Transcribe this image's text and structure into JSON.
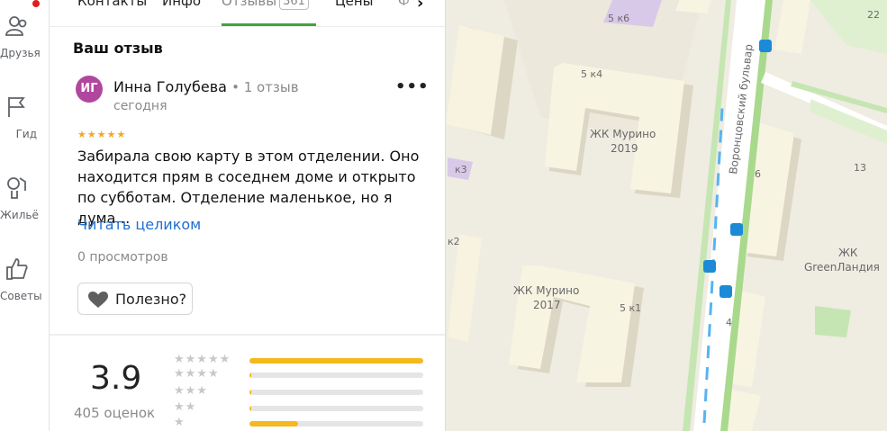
{
  "rail": {
    "items": [
      {
        "label": "Друзья",
        "icon": "friends-icon"
      },
      {
        "label": "Гид",
        "icon": "flag-icon"
      },
      {
        "label": "Жильё",
        "icon": "housing-icon"
      },
      {
        "label": "Советы",
        "icon": "thumbs-up-icon"
      }
    ]
  },
  "tabs": {
    "contacts": "Контакты",
    "info": "Инфо",
    "reviews": "Отзывы",
    "reviews_count": "361",
    "prices": "Цены",
    "next": "Ф"
  },
  "review": {
    "section_title": "Ваш отзыв",
    "avatar_initials": "ИГ",
    "author": "Инна Голубева",
    "meta": "1 отзыв",
    "date": "сегодня",
    "rating_stars": 5,
    "text": "Забирала свою карту в этом отделении. Оно находится прям в соседнем доме и открыто по субботам. Отделение маленькое, но я дума…",
    "read_more": "Читать целиком",
    "views": "0 просмотров",
    "useful": "Полезно?"
  },
  "summary": {
    "rating": "3.9",
    "count": "405 оценок",
    "distribution": [
      {
        "stars": 5,
        "fraction": 1.0
      },
      {
        "stars": 4,
        "fraction": 0.01
      },
      {
        "stars": 3,
        "fraction": 0.01
      },
      {
        "stars": 2,
        "fraction": 0.01
      },
      {
        "stars": 1,
        "fraction": 0.28
      }
    ]
  },
  "map": {
    "labels": [
      {
        "text": "5 к6"
      },
      {
        "text": "5 к4"
      },
      {
        "text": "ЖК Мурино"
      },
      {
        "text": "2019"
      },
      {
        "text": "ЖК Мурино"
      },
      {
        "text": "2017"
      },
      {
        "text": "5 к1"
      },
      {
        "text": "к2"
      },
      {
        "text": "к3"
      },
      {
        "text": "6"
      },
      {
        "text": "13"
      },
      {
        "text": "4"
      },
      {
        "text": "22"
      },
      {
        "text": "ЖК"
      },
      {
        "text": "GreenЛандия"
      },
      {
        "text": "Воронцовский бульвар"
      }
    ]
  },
  "colors": {
    "accent_green": "#3fa537",
    "link_blue": "#1e6fd1",
    "star_gold": "#f5a623",
    "bar_fill": "#f5b81d",
    "avatar": "#b0479e",
    "map_bg": "#f2efe6",
    "building": "#f6f1dd",
    "transit_blue": "#1c8ad6"
  }
}
